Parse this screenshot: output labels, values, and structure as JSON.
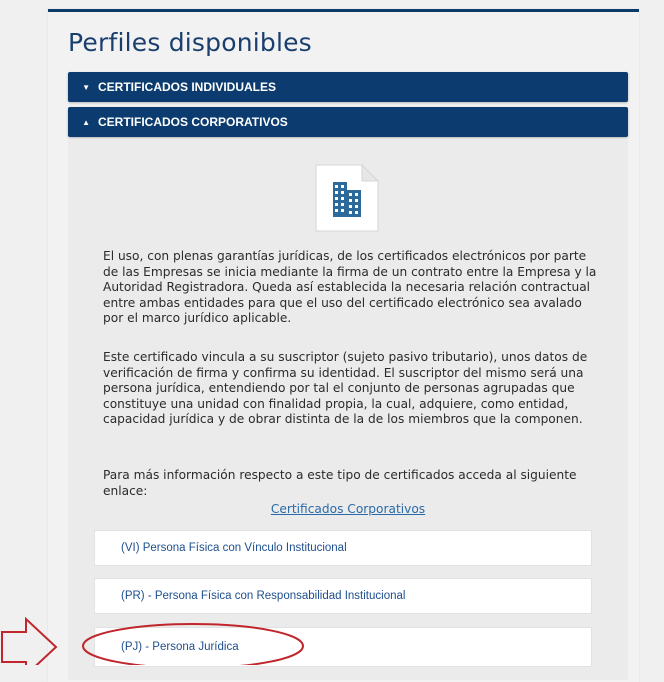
{
  "page": {
    "title": "Perfiles disponibles"
  },
  "accordion": {
    "sections": [
      {
        "label": "CERTIFICADOS INDIVIDUALES",
        "chevron": "▼"
      },
      {
        "label": "CERTIFICADOS CORPORATIVOS",
        "chevron": "▲"
      }
    ]
  },
  "body": {
    "icon": "building-document-icon",
    "paragraphs": [
      "El uso, con plenas garantías jurídicas, de los certificados electrónicos  por parte de las Empresas se inicia mediante la firma de un contrato entre la Empresa y la Autoridad Registradora. Queda así establecida la necesaria relación contractual entre ambas entidades para que el uso del certificado electrónico sea avalado por el marco jurídico aplicable.",
      "Este certificado vincula a su suscriptor (sujeto pasivo tributario), unos datos de verificación de firma y confirma su identidad. El suscriptor del mismo será una persona jurídica, entendiendo por tal el conjunto de personas agrupadas que constituye una unidad con finalidad propia, la cual, adquiere, como entidad, capacidad jurídica y de obrar distinta de la de los miembros que la componen.",
      "Para más información respecto a este tipo de certificados acceda al siguiente enlace:"
    ],
    "link_text": "Certificados Corporativos"
  },
  "profiles": [
    "(VI) Persona Física con Vínculo Institucional",
    "(PR) - Persona Física con Responsabilidad Institucional",
    "(PJ) - Persona Jurídica"
  ],
  "colors": {
    "header_bg": "#0c3c6f",
    "title": "#1a3f6e",
    "link": "#2a6aa8",
    "annotation": "#c0262c"
  }
}
